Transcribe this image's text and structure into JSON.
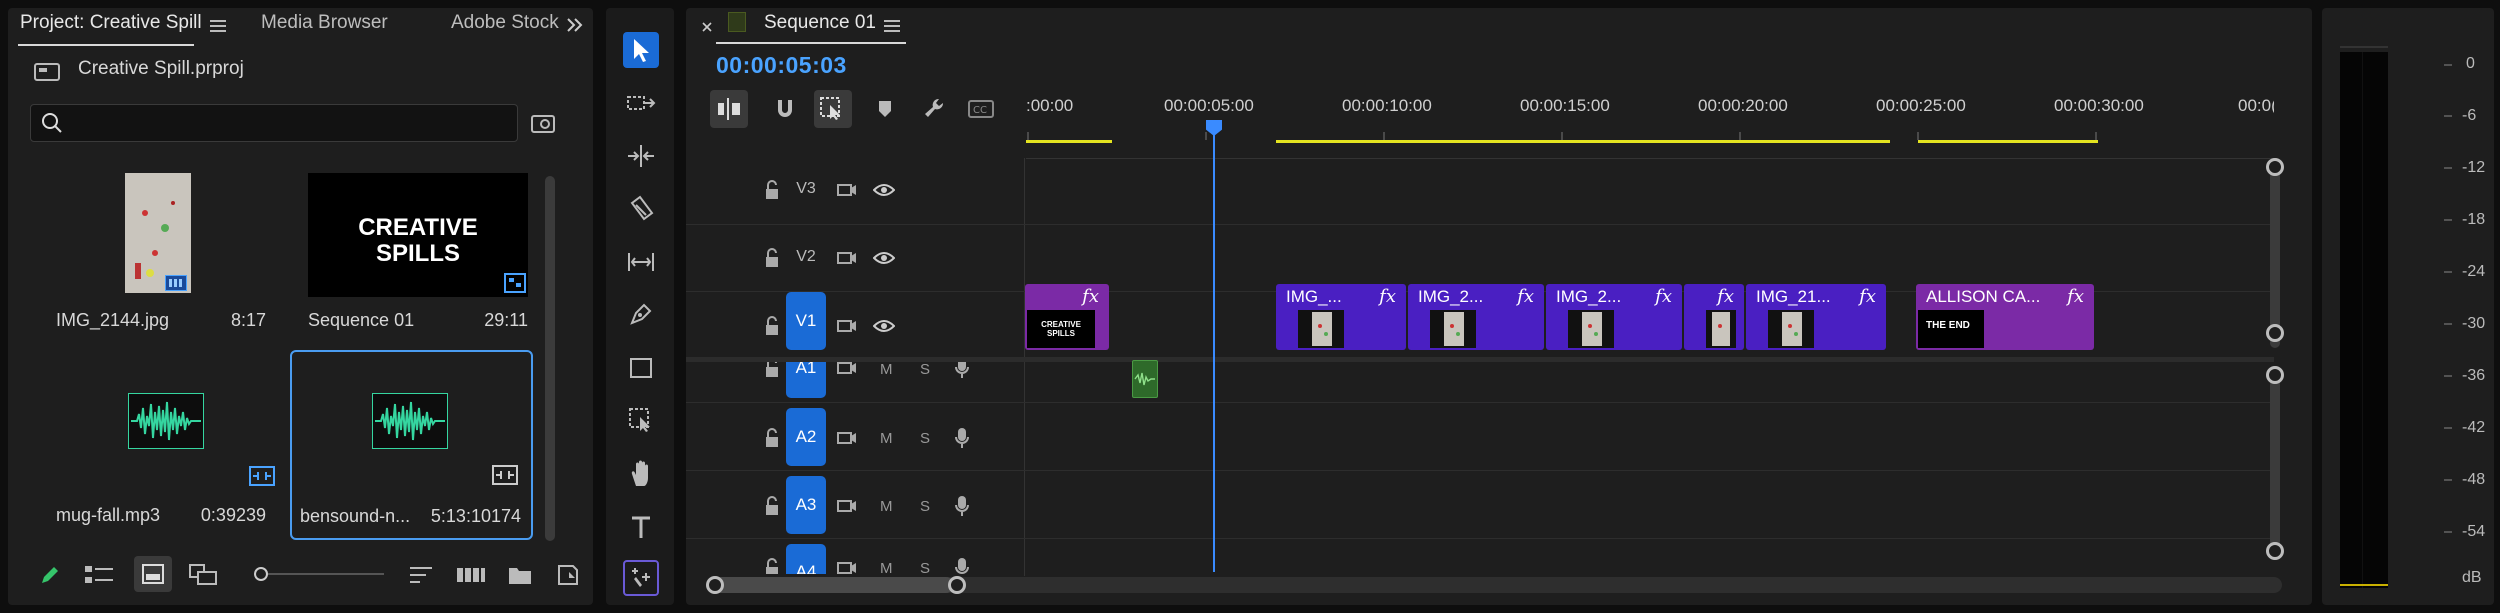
{
  "project_panel": {
    "tabs": [
      "Project: Creative Spill",
      "Media Browser",
      "Adobe Stock"
    ],
    "project_file": "Creative Spill.prproj",
    "search": {
      "value": "",
      "placeholder": ""
    },
    "items": [
      {
        "name": "IMG_2144.jpg",
        "duration": "8:17",
        "selected": false
      },
      {
        "name": "Sequence 01",
        "duration": "29:11",
        "selected": false
      },
      {
        "name": "mug-fall.mp3",
        "duration": "0:39239",
        "selected": false
      },
      {
        "name": "bensound-n...",
        "duration": "5:13:10174",
        "selected": true
      }
    ],
    "sequence_thumb_text": [
      "CREATIVE",
      "SPILLS"
    ]
  },
  "timeline": {
    "sequence_name": "Sequence 01",
    "timecode": "00:00:05:03",
    "ruler_labels": [
      ":00:00",
      "00:00:05:00",
      "00:00:10:00",
      "00:00:15:00",
      "00:00:20:00",
      "00:00:25:00",
      "00:00:30:00",
      "00:0("
    ],
    "video_tracks": [
      "V3",
      "V2",
      "V1"
    ],
    "audio_tracks": [
      "A1",
      "A2",
      "A3",
      "A4"
    ],
    "track_toggles": {
      "mute": "M",
      "solo": "S"
    },
    "clips": [
      {
        "name": "",
        "thumb_text": "CREATIVE SPILLS",
        "color": "#7b2aa6"
      },
      {
        "name": "IMG_...",
        "color": "#4a1fc2"
      },
      {
        "name": "IMG_2...",
        "color": "#4a1fc2"
      },
      {
        "name": "IMG_2...",
        "color": "#4a1fc2"
      },
      {
        "name": "",
        "color": "#4a1fc2"
      },
      {
        "name": "IMG_21...",
        "color": "#4a1fc2"
      },
      {
        "name": "ALLISON CA...",
        "thumb_text": "THE END",
        "color": "#7b2aa6"
      }
    ],
    "fx_label": "fx"
  },
  "audio_meter": {
    "db_labels": [
      "0",
      "-6",
      "-12",
      "-18",
      "-24",
      "-30",
      "-36",
      "-42",
      "-48",
      "-54",
      "dB"
    ]
  },
  "colors": {
    "accent": "#1a6bd6",
    "timecode": "#4aa3ff",
    "playhead": "#3a8bff",
    "work_area": "#e4e420",
    "audio_wave": "#35d6a0"
  }
}
